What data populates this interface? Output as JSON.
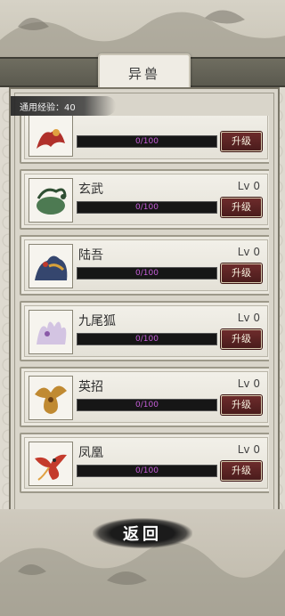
{
  "header": {
    "title": "异兽"
  },
  "exp": {
    "label": "通用经验：40"
  },
  "beasts": [
    {
      "name": "",
      "level": "",
      "progress_text": "0/100",
      "progress": 0,
      "button": "升级",
      "color": "#b0302a"
    },
    {
      "name": "玄武",
      "level": "Lv 0",
      "progress_text": "0/100",
      "progress": 0,
      "button": "升级",
      "color": "#3f6b45"
    },
    {
      "name": "陆吾",
      "level": "Lv 0",
      "progress_text": "0/100",
      "progress": 0,
      "button": "升级",
      "color": "#2d3f66"
    },
    {
      "name": "九尾狐",
      "level": "Lv 0",
      "progress_text": "0/100",
      "progress": 0,
      "button": "升级",
      "color": "#c9b8d8"
    },
    {
      "name": "英招",
      "level": "Lv 0",
      "progress_text": "0/100",
      "progress": 0,
      "button": "升级",
      "color": "#b8862e"
    },
    {
      "name": "凤凰",
      "level": "Lv 0",
      "progress_text": "0/100",
      "progress": 0,
      "button": "升级",
      "color": "#c0392b"
    }
  ],
  "footer": {
    "back_label": "返回"
  }
}
